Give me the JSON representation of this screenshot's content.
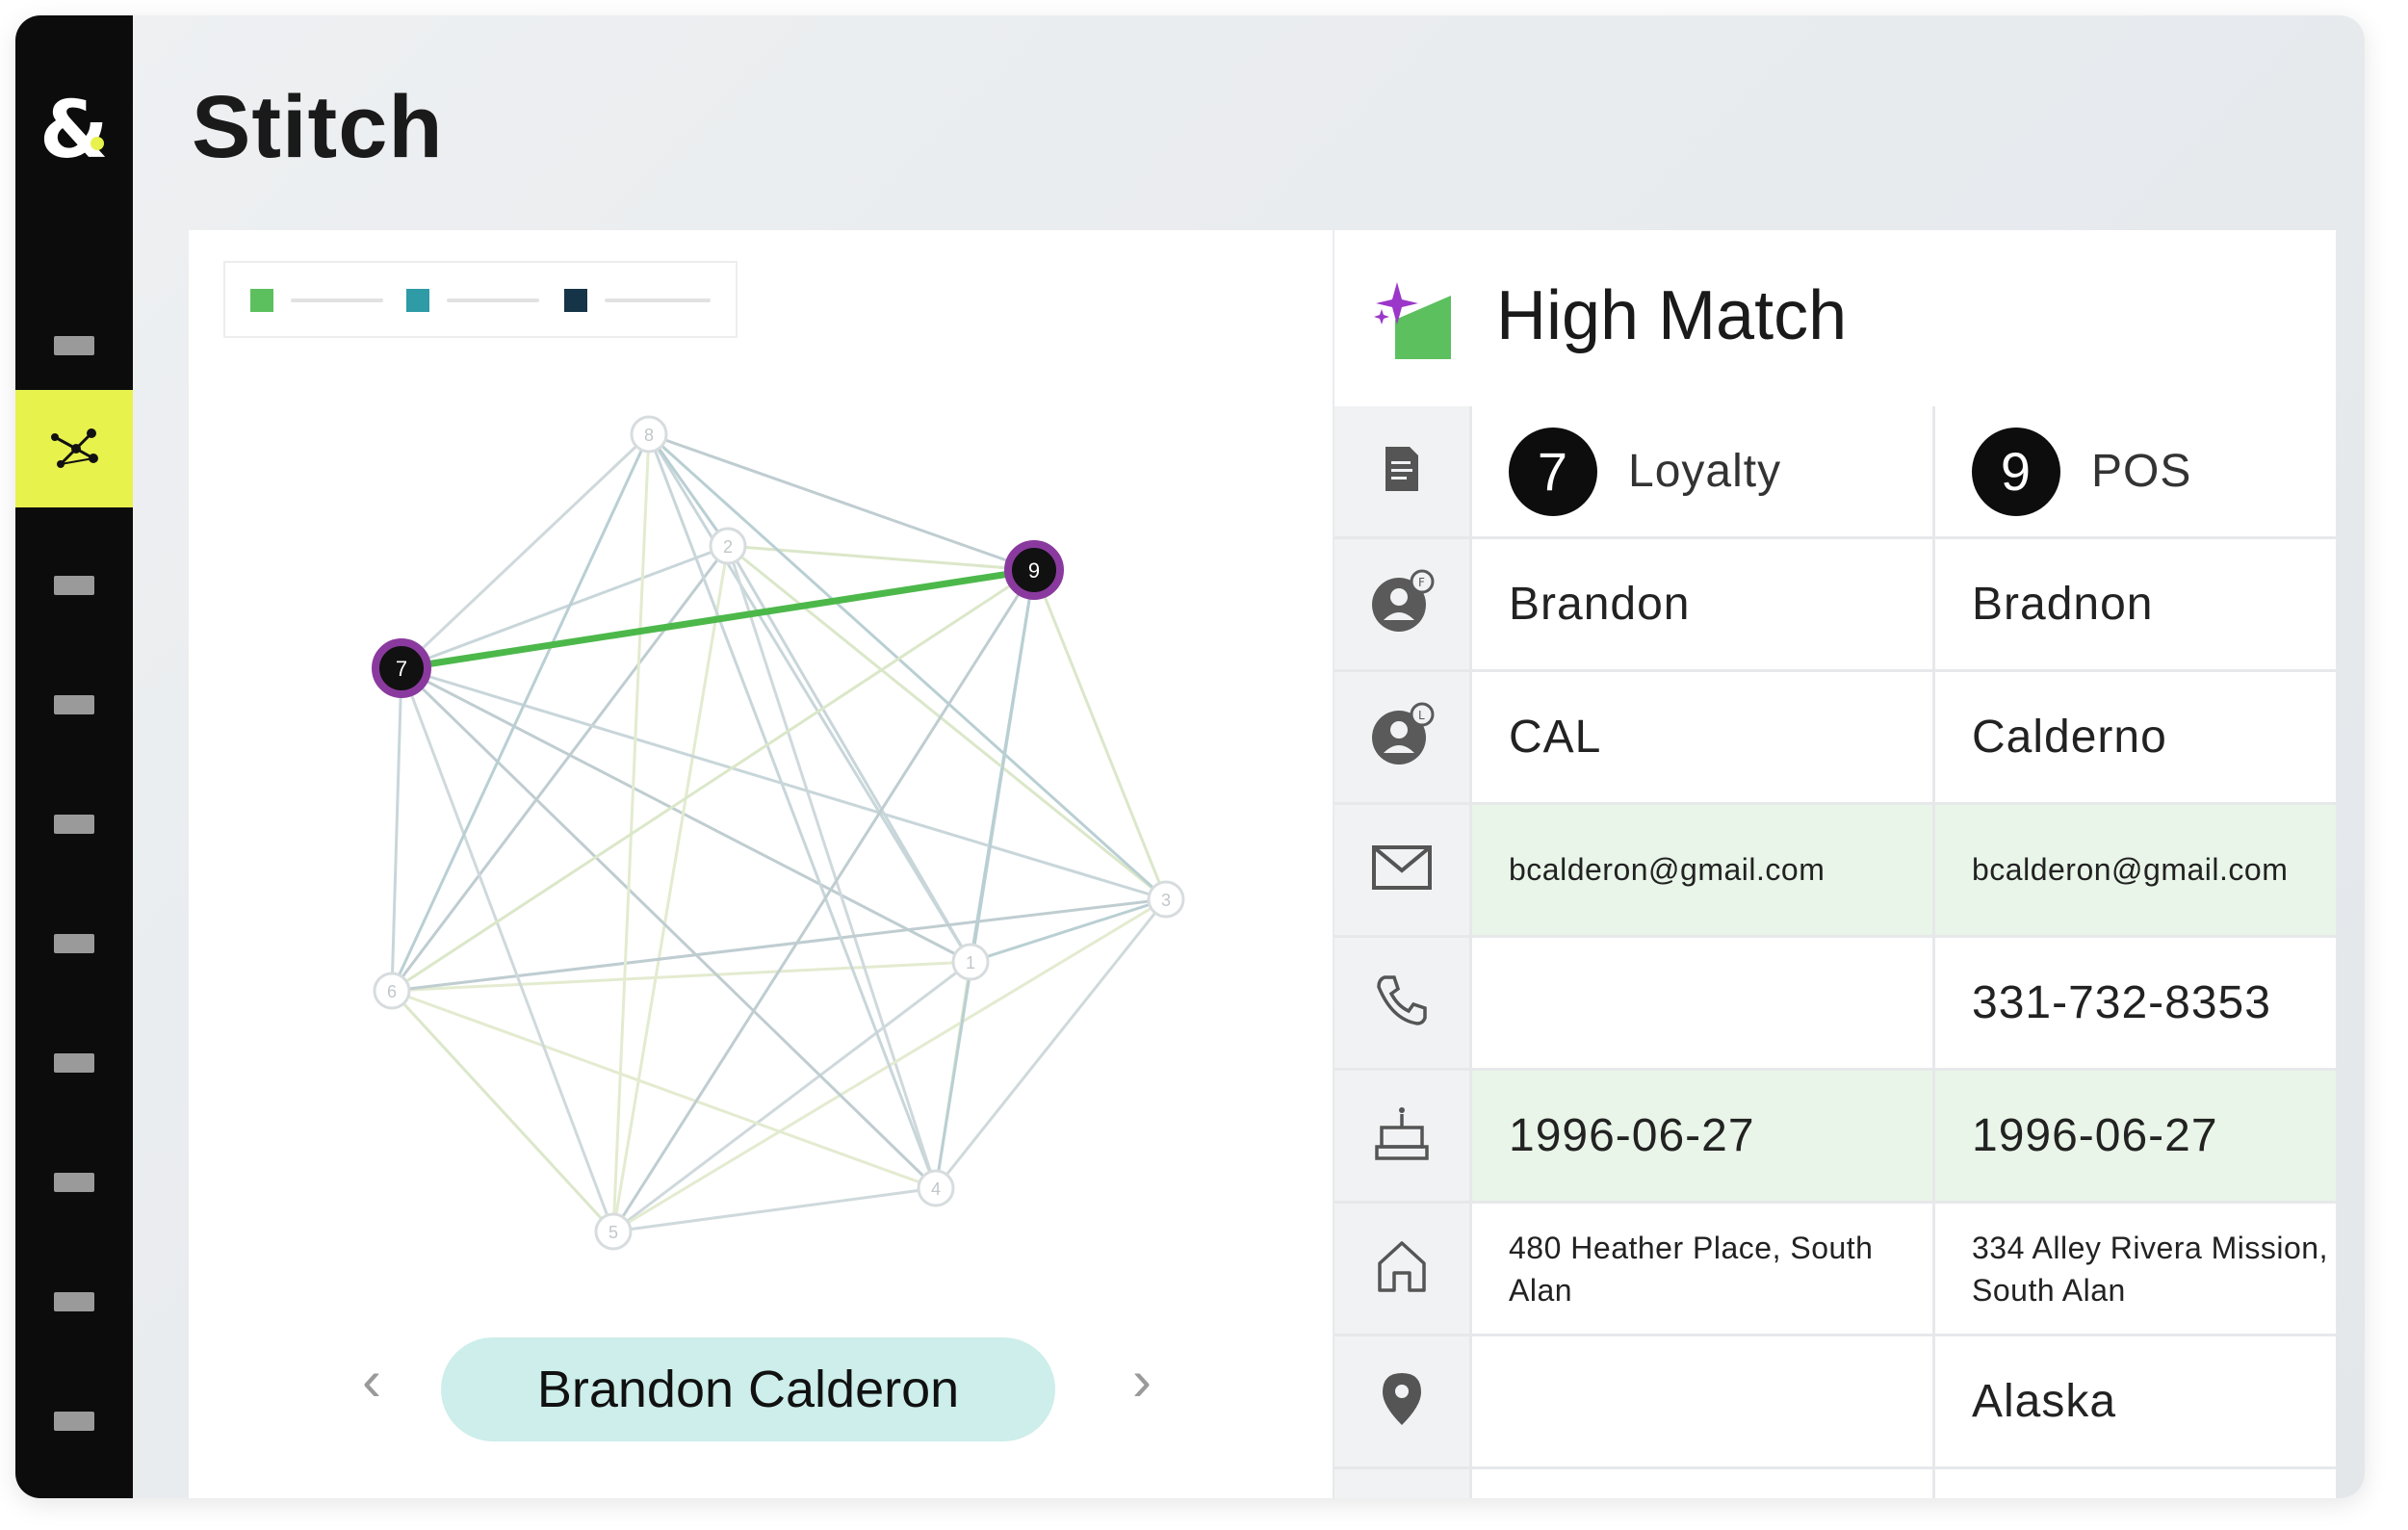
{
  "app": {
    "title": "Stitch"
  },
  "sidebar": {
    "items": [
      {
        "name": "nav-item-1",
        "active": false
      },
      {
        "name": "nav-item-identity-graph",
        "active": true,
        "icon": "network-graph-icon"
      },
      {
        "name": "nav-item-3",
        "active": false
      },
      {
        "name": "nav-item-4",
        "active": false
      },
      {
        "name": "nav-item-5",
        "active": false
      },
      {
        "name": "nav-item-6",
        "active": false
      },
      {
        "name": "nav-item-7",
        "active": false
      },
      {
        "name": "nav-item-8",
        "active": false
      },
      {
        "name": "nav-item-9",
        "active": false
      },
      {
        "name": "nav-item-10",
        "active": false
      }
    ]
  },
  "legend": {
    "colors": [
      "#5cc05e",
      "#2e9ba6",
      "#163447"
    ]
  },
  "graph": {
    "nodes": [
      {
        "label": "1",
        "highlighted": false
      },
      {
        "label": "2",
        "highlighted": false
      },
      {
        "label": "3",
        "highlighted": false
      },
      {
        "label": "4",
        "highlighted": false
      },
      {
        "label": "5",
        "highlighted": false
      },
      {
        "label": "6",
        "highlighted": false
      },
      {
        "label": "7",
        "highlighted": true
      },
      {
        "label": "8",
        "highlighted": false
      },
      {
        "label": "9",
        "highlighted": true
      }
    ],
    "highlight_edge": [
      "7",
      "9"
    ],
    "highlight_color": "#4cb84a",
    "node_ring_color": "#8a3a9e"
  },
  "person": {
    "name": "Brandon Calderon",
    "prev_icon": "chevron-left-icon",
    "next_icon": "chevron-right-icon"
  },
  "match": {
    "title": "High Match",
    "icon": "sparkle-match-icon",
    "sources": [
      {
        "number": "7",
        "label": "Loyalty"
      },
      {
        "number": "9",
        "label": "POS"
      }
    ],
    "rows": [
      {
        "icon": "person-first-name-icon",
        "left": "Brandon",
        "right": "Bradnon",
        "highlight": false
      },
      {
        "icon": "person-last-name-icon",
        "left": "CAL",
        "right": "Calderno",
        "highlight": false
      },
      {
        "icon": "mail-icon",
        "left": "bcalderon@gmail.com",
        "right": "bcalderon@gmail.com",
        "highlight": true
      },
      {
        "icon": "phone-icon",
        "left": "",
        "right": "331-732-8353",
        "highlight": false
      },
      {
        "icon": "birthday-cake-icon",
        "left": "1996-06-27",
        "right": "1996-06-27",
        "highlight": true
      },
      {
        "icon": "home-icon",
        "left": "480 Heather Place, South Alan",
        "right": "334 Alley Rivera Mission, South Alan",
        "highlight": false
      },
      {
        "icon": "location-pin-icon",
        "left": "",
        "right": "Alaska",
        "highlight": false
      }
    ],
    "colors": {
      "highlight_row": "#e9f5e8",
      "accent": "#e8f24d"
    }
  }
}
